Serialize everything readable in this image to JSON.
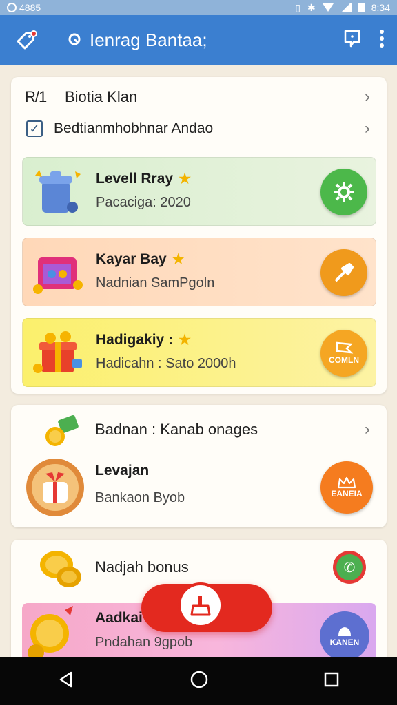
{
  "status_bar": {
    "left_text": "4885",
    "time": "8:34"
  },
  "app_bar": {
    "title": "Ienrag Bantaa;"
  },
  "list_header": {
    "rows": [
      {
        "label": "Biotia Klan",
        "prefix": "R/1"
      },
      {
        "label": "Bedtianmhobhnar Andao"
      }
    ]
  },
  "feature_cards": [
    {
      "title": "Levell Rray",
      "subtitle": "Pacaciga: 2020",
      "action_label": "",
      "color": "#4cb84a"
    },
    {
      "title": "Kayar Bay",
      "subtitle": "Nadnian SamPgoln",
      "action_label": "",
      "color": "#f09a1c"
    },
    {
      "title": "Hadigakiy :",
      "subtitle": "Hadicahn : Sato 2000h",
      "action_label": "COMLN",
      "color": "#f5a623"
    }
  ],
  "rewards_card": {
    "header": "Badnan : Kanab onages",
    "item_title": "Levajan",
    "item_subtitle": "Bankaon Byob",
    "action_label": "EANEIA",
    "action_color": "#f57c1f"
  },
  "bonus_card": {
    "header": "Nadjah bonus",
    "item_title": "Aadkai",
    "item_subtitle": "Pndahan 9gpob",
    "action_label": "KANEN"
  }
}
